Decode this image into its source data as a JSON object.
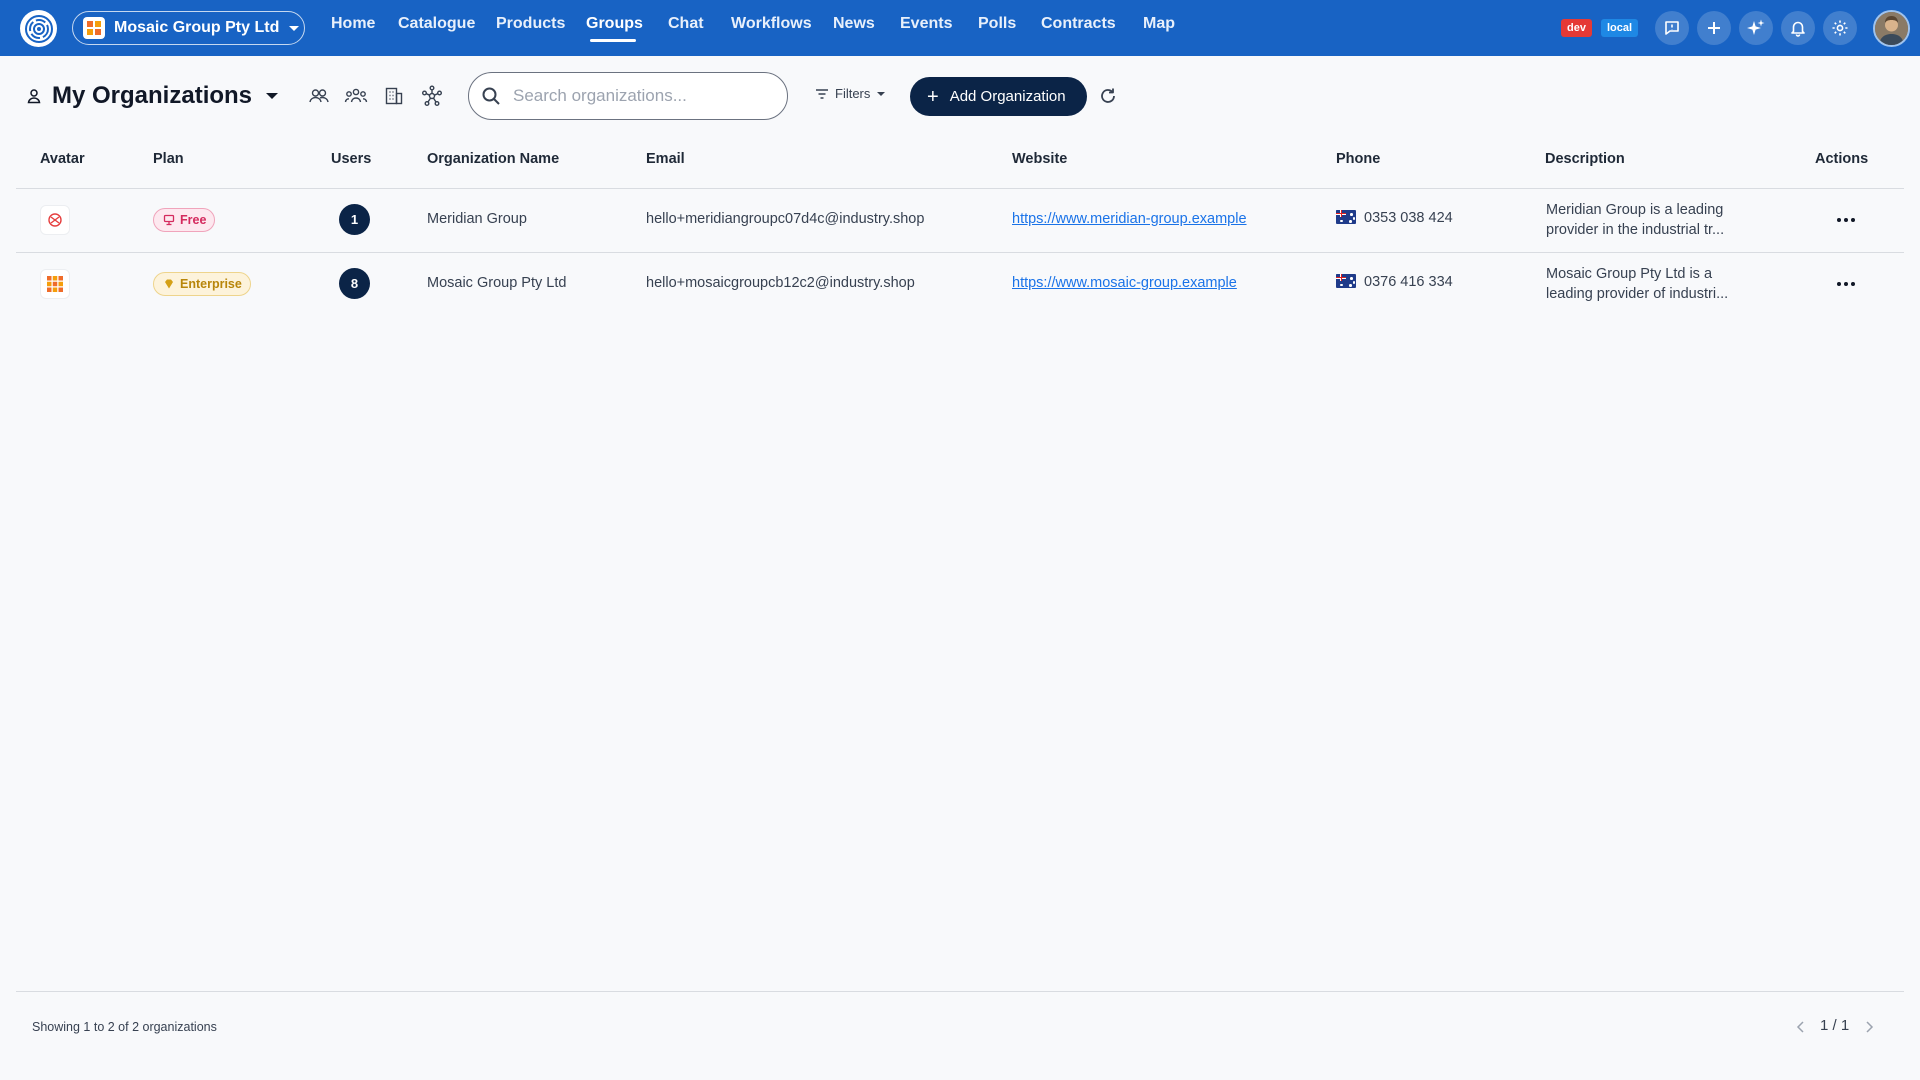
{
  "app": {
    "org_switcher": {
      "label": "Mosaic Group Pty Ltd"
    },
    "nav": [
      {
        "label": "Home"
      },
      {
        "label": "Catalogue"
      },
      {
        "label": "Products"
      },
      {
        "label": "Groups",
        "active": true
      },
      {
        "label": "Chat"
      },
      {
        "label": "Workflows"
      },
      {
        "label": "News"
      },
      {
        "label": "Events"
      },
      {
        "label": "Polls"
      },
      {
        "label": "Contracts"
      },
      {
        "label": "Map"
      }
    ],
    "badges": {
      "dev": "dev",
      "local": "local"
    },
    "top_icons": [
      "chat-bubble-icon",
      "plus-icon",
      "sparkle-icon",
      "bell-icon",
      "gear-icon"
    ]
  },
  "page": {
    "title": "My Organizations",
    "search": {
      "placeholder": "Search organizations...",
      "value": ""
    },
    "filters_label": "Filters",
    "add_button_label": "Add Organization"
  },
  "table": {
    "columns": {
      "avatar": "Avatar",
      "plan": "Plan",
      "users": "Users",
      "name": "Organization Name",
      "email": "Email",
      "website": "Website",
      "phone": "Phone",
      "description": "Description",
      "actions": "Actions"
    },
    "rows": [
      {
        "plan": "Free",
        "users": "1",
        "name": "Meridian Group",
        "email": "hello+meridiangroupc07d4c@industry.shop",
        "website": "https://www.meridian-group.example",
        "phone": "0353 038 424",
        "description_line1": "Meridian Group is a leading",
        "description_line2": "provider in the industrial tr..."
      },
      {
        "plan": "Enterprise",
        "users": "8",
        "name": "Mosaic Group Pty Ltd",
        "email": "hello+mosaicgroupcb12c2@industry.shop",
        "website": "https://www.mosaic-group.example",
        "phone": "0376 416 334",
        "description_line1": "Mosaic Group Pty Ltd is a",
        "description_line2": "leading provider of industri..."
      }
    ]
  },
  "footer": {
    "showing": "Showing 1 to 2 of 2 organizations",
    "page": "1 / 1"
  },
  "colors": {
    "topbar": "#1863c4",
    "primary_dark": "#0b2447",
    "link": "#1a73e8",
    "dev_badge": "#e53935",
    "local_badge": "#1e88e5"
  }
}
